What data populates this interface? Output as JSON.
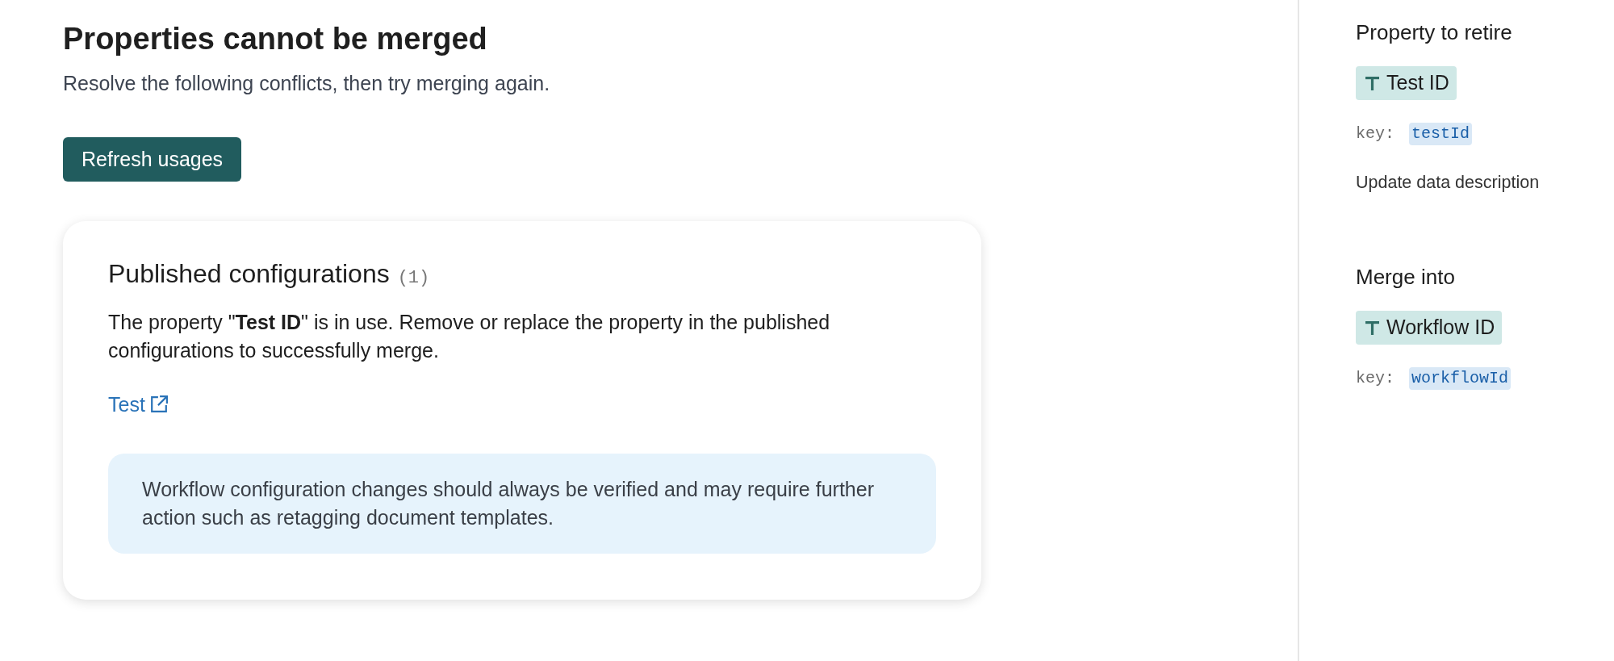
{
  "header": {
    "title": "Properties cannot be merged",
    "subtitle": "Resolve the following conflicts, then try merging again.",
    "button": "Refresh usages"
  },
  "conflicts": [
    {
      "title": "Published configurations",
      "count": "(1)",
      "message": "The property \"**Test ID**\" is in use. Remove or replace the property in the published configurations to successfully merge.",
      "links": [
        {
          "label": "Test"
        }
      ],
      "notice": "Workflow configuration changes should always be verified and may require further action such as retagging document templates."
    }
  ],
  "properties": [
    {
      "heading": "Property to retire",
      "name": "Test ID",
      "key_label": "key:",
      "key": "testId",
      "action": "Update data description"
    },
    {
      "heading": "Merge into",
      "name": "Workflow ID",
      "key_label": "key:",
      "key": "workflowId"
    }
  ]
}
